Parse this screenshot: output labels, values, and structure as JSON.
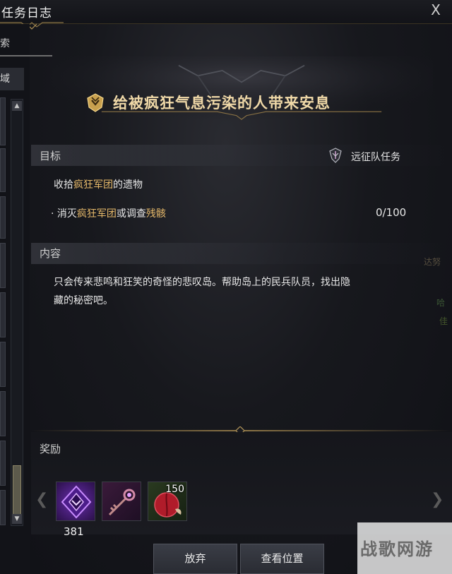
{
  "window": {
    "title": "任务日志",
    "close_glyph": "X"
  },
  "left_panel": {
    "search_tab": "索",
    "filter_label": "域"
  },
  "quest": {
    "title": "给被疯狂气息污染的人带来安息",
    "icon": "quest-crest-icon"
  },
  "objective": {
    "label": "目标",
    "type_label": "远征队任务",
    "type_icon": "expedition-crest-icon",
    "main_prefix": "收拾",
    "main_highlight": "疯狂军团",
    "main_suffix": "的遗物",
    "sub_bullet": "·",
    "sub_prefix": "消灭",
    "sub_highlight1": "疯狂军团",
    "sub_middle": "或调查",
    "sub_highlight2": "残骸",
    "progress": "0/100"
  },
  "content": {
    "label": "内容",
    "line1": "只会传来悲鸣和狂笑的奇怪的悲叹岛。帮助岛上的民兵队员，找出隐",
    "line2": "藏的秘密吧。"
  },
  "rewards": {
    "label": "奖励",
    "items": [
      {
        "name": "purple-crystal-icon",
        "count_below": "381"
      },
      {
        "name": "ornate-key-icon"
      },
      {
        "name": "red-fruit-icon",
        "count_corner": "150"
      }
    ]
  },
  "buttons": {
    "abandon": "放弃",
    "view_location": "查看位置"
  },
  "background_text": {
    "right1": "达努",
    "right2": "哈",
    "right3": "佳"
  },
  "watermark": {
    "text": "战歌网游"
  },
  "colors": {
    "highlight": "#e6b96a",
    "title_gold": "#f0d9a8"
  }
}
